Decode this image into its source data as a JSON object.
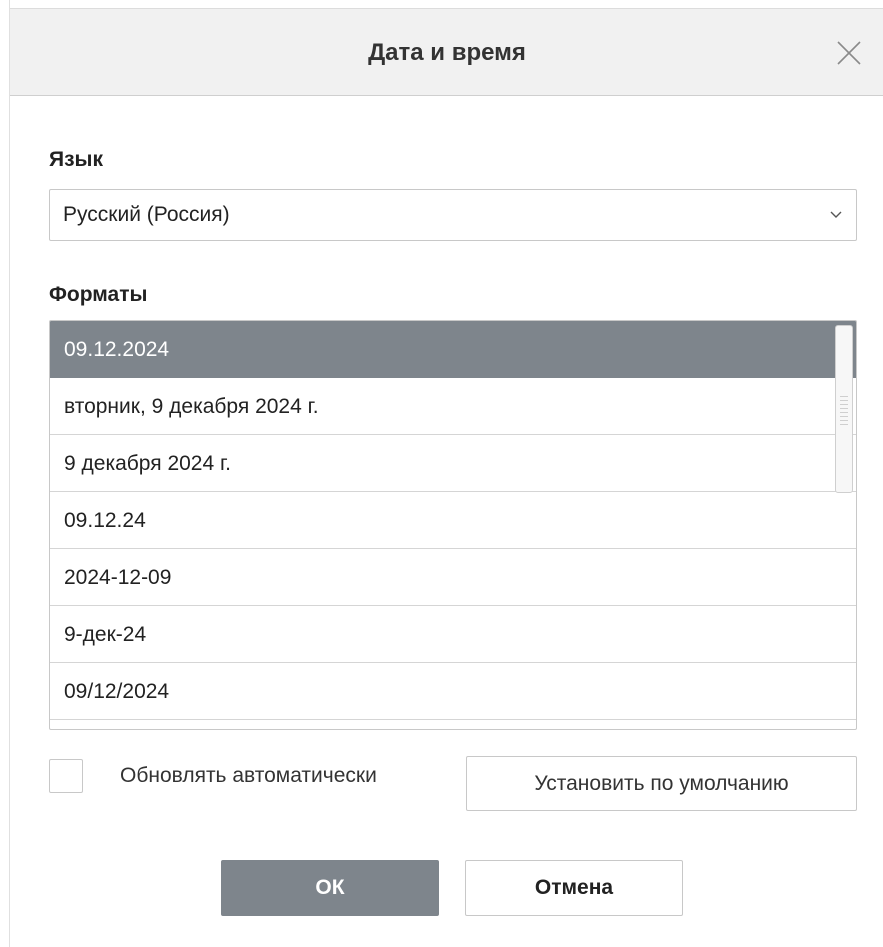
{
  "dialog": {
    "title": "Дата и время",
    "close_icon": "close-icon"
  },
  "language": {
    "label": "Язык",
    "selected": "Русский (Россия)",
    "dropdown_icon": "chevron-down-icon"
  },
  "formats": {
    "label": "Форматы",
    "selected_index": 0,
    "items": [
      "09.12.2024",
      "вторник, 9 декабря 2024 г.",
      "9 декабря 2024 г.",
      "09.12.24",
      "2024-12-09",
      "9-дек-24",
      "09/12/2024"
    ]
  },
  "auto_update": {
    "label": "Обновлять автоматически",
    "checked": false
  },
  "buttons": {
    "set_default": "Установить по умолчанию",
    "ok": "ОК",
    "cancel": "Отмена"
  },
  "colors": {
    "selected_bg": "#7e858c",
    "titlebar_bg": "#f1f1f1",
    "border": "#c8c8c8"
  }
}
